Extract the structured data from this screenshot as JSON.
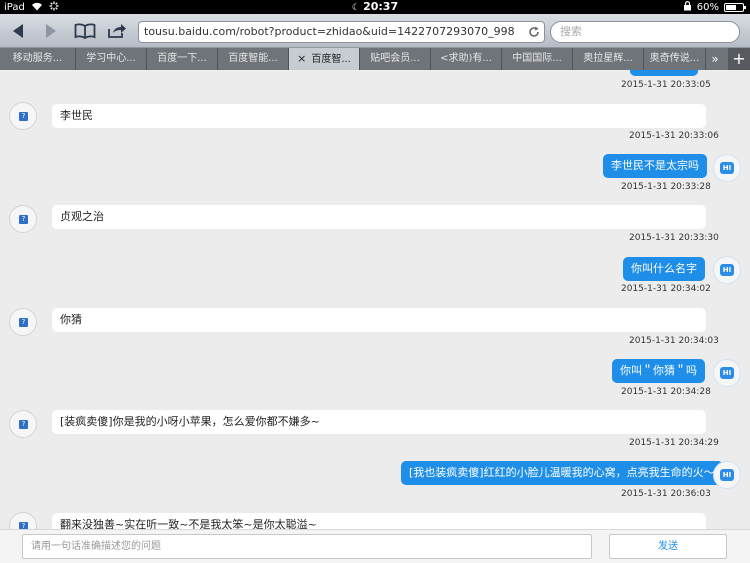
{
  "status_bar": {
    "device": "iPad",
    "time": "20:37",
    "battery": "60%",
    "battery_fraction": 0.6
  },
  "toolbar": {
    "url": "tousu.baidu.com/robot?product=zhidao&uid=1422707293070_998",
    "search_placeholder": "搜索"
  },
  "tabs": [
    {
      "label": "移动服务..."
    },
    {
      "label": "学习中心..."
    },
    {
      "label": "百度一下..."
    },
    {
      "label": "百度智能..."
    },
    {
      "label": "百度智..."
    },
    {
      "label": "贴吧会员..."
    },
    {
      "label": "<求助)有..."
    },
    {
      "label": "中国国际..."
    },
    {
      "label": "奥拉星辉..."
    },
    {
      "label": "奥奇传说..."
    }
  ],
  "messages": [
    {
      "time": "2015-1-31 20:33:05"
    },
    {
      "text": "李世民",
      "time": "2015-1-31 20:33:06"
    },
    {
      "text": "李世民不是太宗吗",
      "time": "2015-1-31 20:33:28"
    },
    {
      "text": "贞观之治",
      "time": "2015-1-31 20:33:30"
    },
    {
      "text": "你叫什么名字",
      "time": "2015-1-31 20:34:02"
    },
    {
      "text": "你猜",
      "time": "2015-1-31 20:34:03"
    },
    {
      "text": "你叫＂你猜＂吗",
      "time": "2015-1-31 20:34:28"
    },
    {
      "text": "[装疯卖傻]你是我的小呀小苹果，怎么爱你都不嫌多~",
      "time": "2015-1-31 20:34:29"
    },
    {
      "text": "[我也装疯卖傻]红红的小脸儿温暖我的心窝，点亮我生命的火～",
      "time": "2015-1-31 20:36:03"
    },
    {
      "text": "翻来没独善~实在听一致~不是我太笨~是你太聪溢~"
    }
  ],
  "input": {
    "placeholder": "请用一句话准确描述您的问题",
    "send_label": "发送"
  }
}
